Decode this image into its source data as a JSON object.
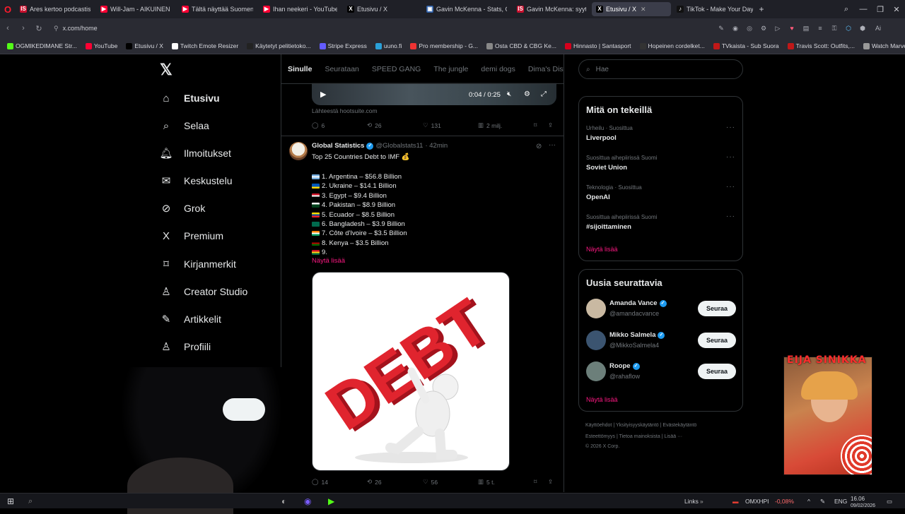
{
  "tabs": [
    {
      "label": "Ares kertoo podcastissa v",
      "fav": "IS",
      "color": "#c8102e",
      "active": false
    },
    {
      "label": "Will-Jam - AIKUINEN - Yo",
      "fav": "▶",
      "color": "#ff0033",
      "active": false
    },
    {
      "label": "Tältä näyttää Suomen suu",
      "fav": "▶",
      "color": "#ff0033",
      "active": false
    },
    {
      "label": "Ihan neekeri - YouTube",
      "fav": "▶",
      "color": "#ff0033",
      "active": false
    },
    {
      "label": "Etusivu / X",
      "fav": "X",
      "color": "#000000",
      "active": false
    },
    {
      "label": "Gavin McKenna - Stats, C",
      "fav": "▣",
      "color": "#2d5fa8",
      "active": false
    },
    {
      "label": "Gavin McKenna: syytettä",
      "fav": "IS",
      "color": "#c8102e",
      "active": false
    },
    {
      "label": "Etusivu / X",
      "fav": "X",
      "color": "#000000",
      "active": true
    },
    {
      "label": "TikTok - Make Your Day",
      "fav": "♪",
      "color": "#111111",
      "active": false
    }
  ],
  "browser": {
    "logo": "O",
    "url": "x.com/home",
    "new_tab": "+"
  },
  "bookmarks": [
    {
      "label": "OGMIKEDIMANE Str...",
      "color": "#53fc18"
    },
    {
      "label": "YouTube",
      "color": "#ff0033"
    },
    {
      "label": "Etusivu / X",
      "color": "#000000"
    },
    {
      "label": "Twitch Emote Resizer",
      "color": "#ffffff"
    },
    {
      "label": "Käytetyt pelitietoko...",
      "color": "#222222"
    },
    {
      "label": "Stripe Express",
      "color": "#635bff"
    },
    {
      "label": "uuno.fi",
      "color": "#2aa0d8"
    },
    {
      "label": "Pro membership - G...",
      "color": "#e33"
    },
    {
      "label": "Osta CBD & CBG Ke...",
      "color": "#888888"
    },
    {
      "label": "Hinnasto | Santasport",
      "color": "#d6001c"
    },
    {
      "label": "Hopeinen cordelket...",
      "color": "#333333"
    },
    {
      "label": "TVkaista - Sub Suora",
      "color": "#c01818"
    },
    {
      "label": "Travis Scott: Outfits,...",
      "color": "#c01818"
    },
    {
      "label": "Watch Marvel's Luk...",
      "color": "#999999"
    }
  ],
  "nav": [
    {
      "label": "Etusivu",
      "icon": "home-icon",
      "glyph": "⌂",
      "bold": true
    },
    {
      "label": "Selaa",
      "icon": "search-icon",
      "glyph": "⌕",
      "bold": false
    },
    {
      "label": "Ilmoitukset",
      "icon": "bell-icon",
      "glyph": "🔔︎",
      "bold": false
    },
    {
      "label": "Keskustelu",
      "icon": "mail-icon",
      "glyph": "✉",
      "bold": false
    },
    {
      "label": "Grok",
      "icon": "grok-icon",
      "glyph": "⊘",
      "bold": false
    },
    {
      "label": "Premium",
      "icon": "x-icon",
      "glyph": "X",
      "bold": false
    },
    {
      "label": "Kirjanmerkit",
      "icon": "bookmark-icon",
      "glyph": "⌑",
      "bold": false
    },
    {
      "label": "Creator Studio",
      "icon": "creator-icon",
      "glyph": "♙",
      "bold": false
    },
    {
      "label": "Artikkelit",
      "icon": "article-icon",
      "glyph": "✎",
      "bold": false
    },
    {
      "label": "Profiili",
      "icon": "profile-icon",
      "glyph": "♙",
      "bold": false
    },
    {
      "label": "Lisää",
      "icon": "more-icon",
      "glyph": "⋯",
      "bold": false
    }
  ],
  "timeline": {
    "tabs": [
      "Sinulle",
      "Seurataan",
      "SPEED GANG",
      "The jungle",
      "demi dogs",
      "Dima's Dist"
    ],
    "video_time": "0:04 / 0:25",
    "source": "Lähteestä hootsuite.com",
    "post1_stats": {
      "replies": "6",
      "reposts": "26",
      "likes": "131",
      "views": "2 milj."
    },
    "post2": {
      "name": "Global Statistics",
      "handle": "@Globalstats11",
      "time": "· 42min",
      "title": "Top 25 Countries Debt to IMF 💰",
      "items": [
        {
          "text": "1. Argentina – $56.8 Billion",
          "flag": [
            "#74acdf",
            "#ffffff",
            "#74acdf"
          ]
        },
        {
          "text": "2. Ukraine – $14.1 Billion",
          "flag": [
            "#0057b7",
            "#0057b7",
            "#ffd700"
          ]
        },
        {
          "text": "3. Egypt – $9.4 Billion",
          "flag": [
            "#ce1126",
            "#ffffff",
            "#000000"
          ]
        },
        {
          "text": "4. Pakistan – $8.9 Billion",
          "flag": [
            "#ffffff",
            "#01411c",
            "#01411c"
          ]
        },
        {
          "text": "5. Ecuador – $8.5 Billion",
          "flag": [
            "#ffdd00",
            "#034ea2",
            "#ed1c24"
          ]
        },
        {
          "text": "6. Bangladesh – $3.9 Billion",
          "flag": [
            "#006a4e",
            "#006a4e",
            "#006a4e"
          ]
        },
        {
          "text": "7. Côte d'Ivoire – $3.5 Billion",
          "flag": [
            "#f77f00",
            "#ffffff",
            "#009e60"
          ]
        },
        {
          "text": "8. Kenya – $3.5 Billion",
          "flag": [
            "#000000",
            "#bb0000",
            "#006600"
          ]
        },
        {
          "text": "9.",
          "flag": [
            "#ce1126",
            "#fcd116",
            "#006b3f"
          ]
        }
      ],
      "show_more": "Näytä lisää",
      "image_word": "DEBT",
      "stats": {
        "replies": "14",
        "reposts": "26",
        "likes": "56",
        "views": "5 t."
      }
    }
  },
  "right": {
    "search_placeholder": "Hae",
    "trends_title": "Mitä on tekeillä",
    "trends": [
      {
        "meta": "Urheilu · Suosittua",
        "name": "Liverpool"
      },
      {
        "meta": "Suosittua aihepiirissä Suomi",
        "name": "Soviet Union"
      },
      {
        "meta": "Teknologia · Suosittua",
        "name": "OpenAI"
      },
      {
        "meta": "Suosittua aihepiirissä Suomi",
        "name": "#sijoittaminen"
      }
    ],
    "trends_more": "Näytä lisää",
    "follow_title": "Uusia seurattavia",
    "follows": [
      {
        "name": "Amanda Vance",
        "handle": "@amandacvance",
        "btn": "Seuraa",
        "avatar": "#c9b9a2"
      },
      {
        "name": "Mikko Salmela",
        "handle": "@MikkoSalmela4",
        "btn": "Seuraa",
        "avatar": "#3b5470"
      },
      {
        "name": "Roope",
        "handle": "@rahaflow",
        "btn": "Seuraa",
        "avatar": "#6c7f7a"
      }
    ],
    "follow_more": "Näytä lisää",
    "footer": {
      "line1": [
        "Käyttöehdot",
        "Yksityisyyskäytäntö",
        "Evästekäytäntö"
      ],
      "line2": [
        "Esteettömyys",
        "Tietoa mainoksista",
        "Lisää ···"
      ],
      "copyright": "© 2026 X Corp."
    }
  },
  "overlay": {
    "webcam_title": "EIJA SINIKKA"
  },
  "taskbar": {
    "links": "Links",
    "ticker": "OMXHPI",
    "change": "-0,08%",
    "lang": "ENG",
    "time": "16.06",
    "date": "09/02/2026"
  }
}
